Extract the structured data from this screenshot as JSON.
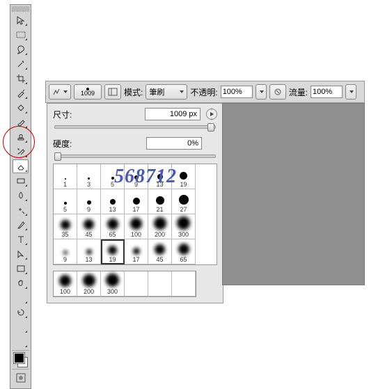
{
  "toolbar": {
    "tools": [
      "move",
      "rect-marquee",
      "lasso",
      "magic-wand",
      "crop",
      "eyedropper",
      "heal",
      "brush",
      "stamp",
      "history-brush",
      "eraser",
      "gradient",
      "blur",
      "dodge",
      "pen",
      "type",
      "path-select",
      "rectangle",
      "hand",
      "zoom",
      "rotate-view",
      "3d-rotate",
      "3d-orbit"
    ]
  },
  "options": {
    "brush_size": "1009",
    "mode_label": "模式:",
    "mode_value": "筆刷",
    "opacity_label": "不透明:",
    "opacity_value": "100%",
    "flow_label": "流量:",
    "flow_value": "100%"
  },
  "panel": {
    "size_label": "尺寸:",
    "size_value": "1009 px",
    "hardness_label": "硬度:",
    "hardness_value": "0%",
    "brushes_hard": [
      {
        "n": "1",
        "d": 2
      },
      {
        "n": "3",
        "d": 3
      },
      {
        "n": "5",
        "d": 4
      },
      {
        "n": "9",
        "d": 6
      },
      {
        "n": "13",
        "d": 8
      },
      {
        "n": "19",
        "d": 11
      },
      {
        "n": "5",
        "d": 4
      },
      {
        "n": "9",
        "d": 6
      },
      {
        "n": "13",
        "d": 8
      },
      {
        "n": "17",
        "d": 10
      },
      {
        "n": "21",
        "d": 12
      },
      {
        "n": "27",
        "d": 14
      },
      {
        "n": "35",
        "d": 14
      },
      {
        "n": "45",
        "d": 15
      },
      {
        "n": "65",
        "d": 16
      },
      {
        "n": "100",
        "d": 17
      },
      {
        "n": "200",
        "d": 18
      },
      {
        "n": "300",
        "d": 19
      },
      {
        "n": "9",
        "d": 6,
        "s": 1
      },
      {
        "n": "13",
        "d": 8,
        "s": 1
      },
      {
        "n": "19",
        "d": 13,
        "s": 1,
        "sel": 1
      },
      {
        "n": "17",
        "d": 10,
        "s": 1
      },
      {
        "n": "45",
        "d": 15,
        "s": 1
      },
      {
        "n": "65",
        "d": 16,
        "s": 1
      }
    ],
    "brushes_soft": [
      {
        "n": "100",
        "d": 17
      },
      {
        "n": "200",
        "d": 18
      },
      {
        "n": "300",
        "d": 19
      }
    ]
  },
  "watermark": "568712"
}
